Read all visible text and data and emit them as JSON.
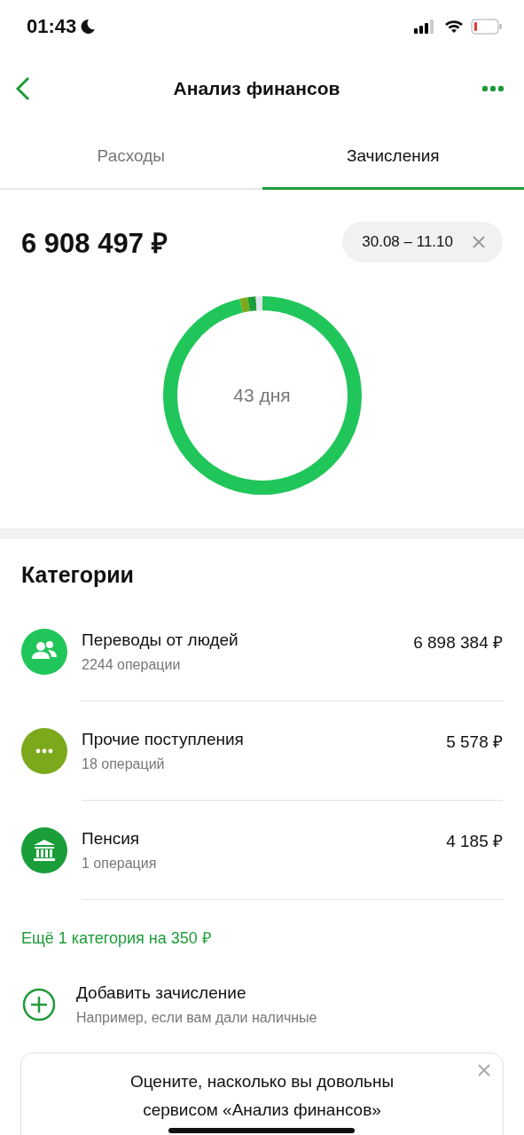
{
  "status_bar": {
    "time": "01:43"
  },
  "header": {
    "title": "Анализ финансов"
  },
  "tabs": [
    {
      "label": "Расходы",
      "selected": false
    },
    {
      "label": "Зачисления",
      "selected": true
    }
  ],
  "total": {
    "amount": "6 908 497 ₽",
    "period": "30.08 – 11.10"
  },
  "donut": {
    "center_label": "43 дня"
  },
  "categories": {
    "title": "Категории",
    "items": [
      {
        "name": "Переводы от людей",
        "count": "2244 операции",
        "amount": "6 898 384 ₽",
        "color": "#21c65a",
        "kind": "people"
      },
      {
        "name": "Прочие поступления",
        "count": "18 операций",
        "amount": "5 578 ₽",
        "color": "#7ca81c",
        "kind": "dots"
      },
      {
        "name": "Пенсия",
        "count": "1 операция",
        "amount": "4 185 ₽",
        "color": "#1a9e3a",
        "kind": "bank"
      }
    ],
    "more_link": "Ещё 1 категория на 350 ₽"
  },
  "add_income": {
    "title": "Добавить зачисление",
    "hint": "Например, если вам дали наличные"
  },
  "survey": {
    "text": "Оцените, насколько вы довольны сервисом «Анализ финансов»"
  }
}
